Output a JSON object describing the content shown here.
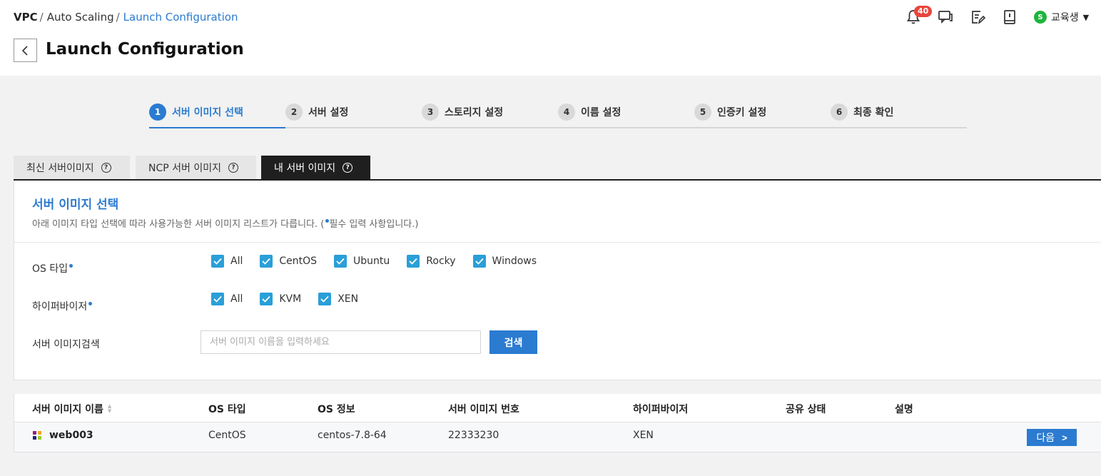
{
  "breadcrumb": {
    "items": [
      "VPC",
      "Auto Scaling",
      "Launch Configuration"
    ],
    "separator": "/"
  },
  "page": {
    "title": "Launch Configuration"
  },
  "header": {
    "notification_count": "40",
    "user_initial": "S",
    "user_name": "교육생",
    "icons": [
      "bell-icon",
      "chat-icon",
      "edit-note-icon",
      "book-icon",
      "caret-down-icon"
    ]
  },
  "steps": [
    {
      "num": "1",
      "label": "서버 이미지 선택",
      "active": true
    },
    {
      "num": "2",
      "label": "서버 설정"
    },
    {
      "num": "3",
      "label": "스토리지 설정"
    },
    {
      "num": "4",
      "label": "이름 설정"
    },
    {
      "num": "5",
      "label": "인증키 설정"
    },
    {
      "num": "6",
      "label": "최종 확인"
    }
  ],
  "tabs": [
    {
      "label": "최신 서버이미지"
    },
    {
      "label": "NCP 서버 이미지"
    },
    {
      "label": "내 서버 이미지",
      "active": true
    }
  ],
  "panel": {
    "title": "서버 이미지 선택",
    "desc_before": "아래 이미지 타입 선택에 따라 사용가능한 서버 이미지 리스트가 다릅니다. (",
    "desc_after": "필수 입력 사항입니다.)"
  },
  "filters": {
    "os_label": "OS 타입",
    "os_options": [
      {
        "label": "All",
        "checked": true
      },
      {
        "label": "CentOS",
        "checked": true
      },
      {
        "label": "Ubuntu",
        "checked": true
      },
      {
        "label": "Rocky",
        "checked": true
      },
      {
        "label": "Windows",
        "checked": true
      }
    ],
    "hv_label": "하이퍼바이저",
    "hv_options": [
      {
        "label": "All",
        "checked": true
      },
      {
        "label": "KVM",
        "checked": true
      },
      {
        "label": "XEN",
        "checked": true
      }
    ],
    "search_label": "서버 이미지검색",
    "search_placeholder": "서버 이미지 이름을 입력하세요",
    "search_value": "",
    "search_button": "검색"
  },
  "table": {
    "columns": [
      "서버 이미지 이름",
      "OS 타입",
      "OS 정보",
      "서버 이미지 번호",
      "하이퍼바이저",
      "공유 상태",
      "설명"
    ],
    "rows": [
      {
        "name": "web003",
        "os_type": "CentOS",
        "os_info": "centos-7.8-64",
        "image_no": "22333230",
        "hypervisor": "XEN",
        "share_status": "",
        "description": "",
        "action": "다음"
      }
    ]
  },
  "colors": {
    "accent": "#2b7bd0",
    "checkbox": "#2a9fd8",
    "badge": "#e8453c",
    "user_dot": "#1eb43c",
    "tab_active": "#1f1f1f"
  }
}
